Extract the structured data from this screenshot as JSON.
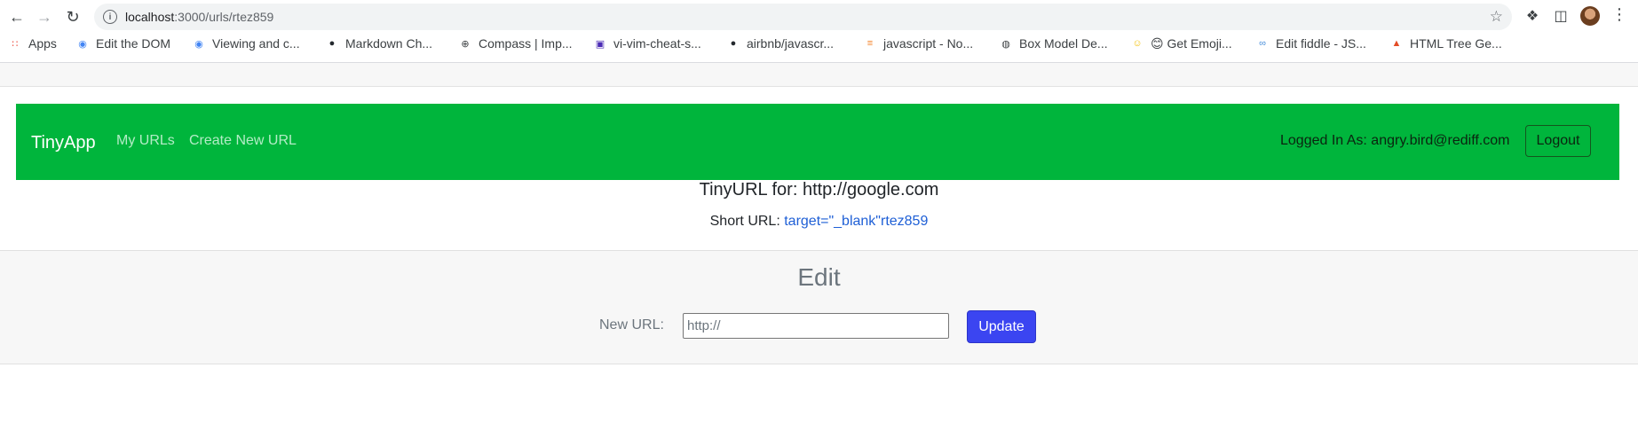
{
  "browser": {
    "url_host": "localhost",
    "url_path": ":3000/urls/rtez859",
    "bookmarks": [
      {
        "label": "Apps",
        "icon": "apps-grid-icon",
        "color": "#ea4335"
      },
      {
        "label": "Edit the DOM",
        "icon": "chrome-icon",
        "color": "#4285f4"
      },
      {
        "label": "Viewing and c...",
        "icon": "chrome-icon",
        "color": "#4285f4"
      },
      {
        "label": "Markdown Ch...",
        "icon": "github-icon",
        "color": "#24292e"
      },
      {
        "label": "Compass | Imp...",
        "icon": "compass-icon",
        "color": "#3c4043"
      },
      {
        "label": "vi-vim-cheat-s...",
        "icon": "vim-icon",
        "color": "#4b2bb5"
      },
      {
        "label": "airbnb/javascr...",
        "icon": "github-icon",
        "color": "#24292e"
      },
      {
        "label": "javascript - No...",
        "icon": "stackoverflow-icon",
        "color": "#f48024"
      },
      {
        "label": "Box Model De...",
        "icon": "globe-icon",
        "color": "#3c4043"
      },
      {
        "label": "😊 Get Emoji...",
        "icon": "emoji-icon",
        "color": "#f4c20d"
      },
      {
        "label": "Edit fiddle - JS...",
        "icon": "jsfiddle-icon",
        "color": "#4a8fdb"
      },
      {
        "label": "HTML Tree Ge...",
        "icon": "tree-icon",
        "color": "#e34c26"
      }
    ]
  },
  "navbar": {
    "brand": "TinyApp",
    "links": [
      "My URLs",
      "Create New URL"
    ],
    "logged_in_text": "Logged In As: angry.bird@rediff.com",
    "logout_label": "Logout",
    "bg_color": "#00b53c"
  },
  "details": {
    "title": "TinyURL for: http://google.com",
    "short_url_label": "Short URL:",
    "short_url_link": "target=\"_blank\"rtez859"
  },
  "edit": {
    "title": "Edit",
    "new_url_label": "New URL:",
    "input_placeholder": "http://",
    "update_label": "Update",
    "button_color": "#3b45f1"
  }
}
